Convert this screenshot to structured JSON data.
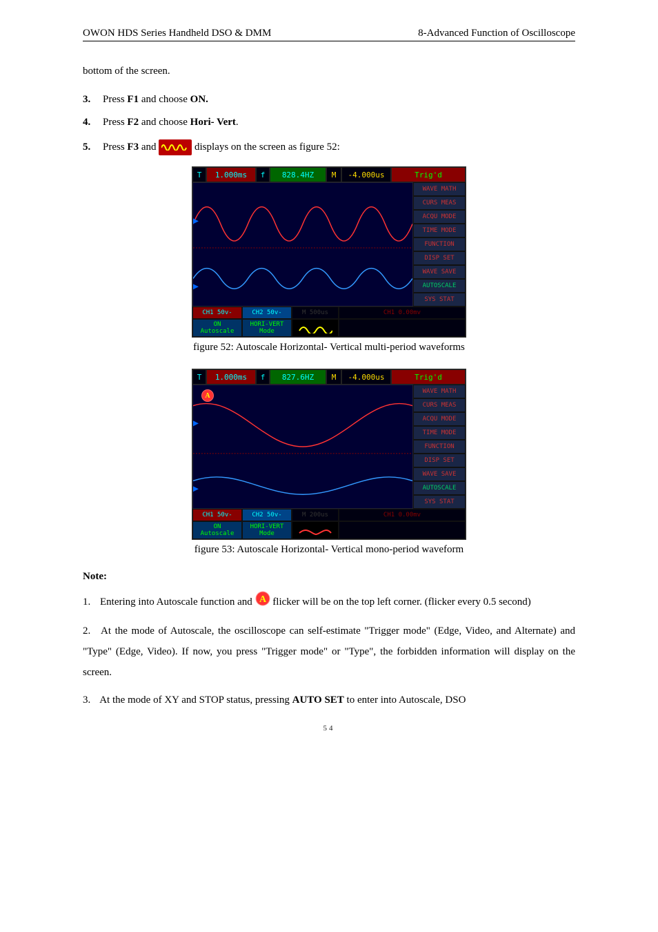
{
  "header": {
    "left": "OWON    HDS Series Handheld DSO & DMM",
    "right": "8-Advanced Function of Oscilloscope"
  },
  "intro_line": "bottom of the screen.",
  "steps": {
    "s3": {
      "num": "3.",
      "pre": "Press ",
      "key": "F1",
      "mid": " and choose ",
      "opt": "ON."
    },
    "s4": {
      "num": "4.",
      "pre": "Press ",
      "key": "F2",
      "mid": " and choose ",
      "opt": "Hori- Vert",
      "post": "."
    },
    "s5": {
      "num": "5.",
      "pre": "Press ",
      "key": "F3",
      "mid": " and ",
      "post": "  displays on the screen as figure 52:"
    }
  },
  "scope1": {
    "t_label": "T",
    "time": "1.000ms",
    "f_label": "f",
    "freq": "828.4HZ",
    "m_label": "M",
    "offset": "-4.000us",
    "trig": "Trig'd",
    "side": [
      "WAVE MATH",
      "CURS MEAS",
      "ACQU MODE",
      "TIME MODE",
      "FUNCTION",
      "DISP SET",
      "WAVE SAVE",
      "AUTOSCALE",
      "SYS STAT"
    ],
    "ch1": "CH1 50v-",
    "ch2": "CH2 50v-",
    "mseg": "M 500us",
    "chtrig": "CH1 0.00mv",
    "bot_on_top": "ON",
    "bot_on_sub": "Autoscale",
    "bot_mode_top": "HORI-VERT",
    "bot_mode_sub": "Mode"
  },
  "caption1": "figure 52: Autoscale Horizontal- Vertical multi-period waveforms",
  "scope2": {
    "t_label": "T",
    "time": "1.000ms",
    "f_label": "f",
    "freq": "827.6HZ",
    "m_label": "M",
    "offset": "-4.000us",
    "trig": "Trig'd",
    "side": [
      "WAVE MATH",
      "CURS MEAS",
      "ACQU MODE",
      "TIME MODE",
      "FUNCTION",
      "DISP SET",
      "WAVE SAVE",
      "AUTOSCALE",
      "SYS STAT"
    ],
    "ch1": "CH1 50v-",
    "ch2": "CH2 50v-",
    "mseg": "M 200us",
    "chtrig": "CH1 0.00mv",
    "bot_on_top": "ON",
    "bot_on_sub": "Autoscale",
    "bot_mode_top": "HORI-VERT",
    "bot_mode_sub": "Mode",
    "a_badge": "A"
  },
  "caption2": "figure 53: Autoscale Horizontal- Vertical mono-period waveform",
  "note_head": "Note:",
  "notes": {
    "n1": {
      "num": "1.",
      "pre": "Entering into Autoscale function and ",
      "post": " flicker will be on the top left corner. (flicker every 0.5 second)"
    },
    "n2": {
      "num": "2.",
      "text": "At the mode of Autoscale, the oscilloscope can self-estimate \"Trigger mode\" (Edge, Video, and Alternate) and \"Type\" (Edge, Video). If now, you press \"Trigger mode\" or \"Type\", the forbidden information will display on the screen."
    },
    "n3": {
      "num": "3.",
      "pre": "At the mode of XY and STOP status, pressing ",
      "key": "AUTO SET",
      "post": " to enter into Autoscale, DSO"
    }
  },
  "page_num": "54"
}
